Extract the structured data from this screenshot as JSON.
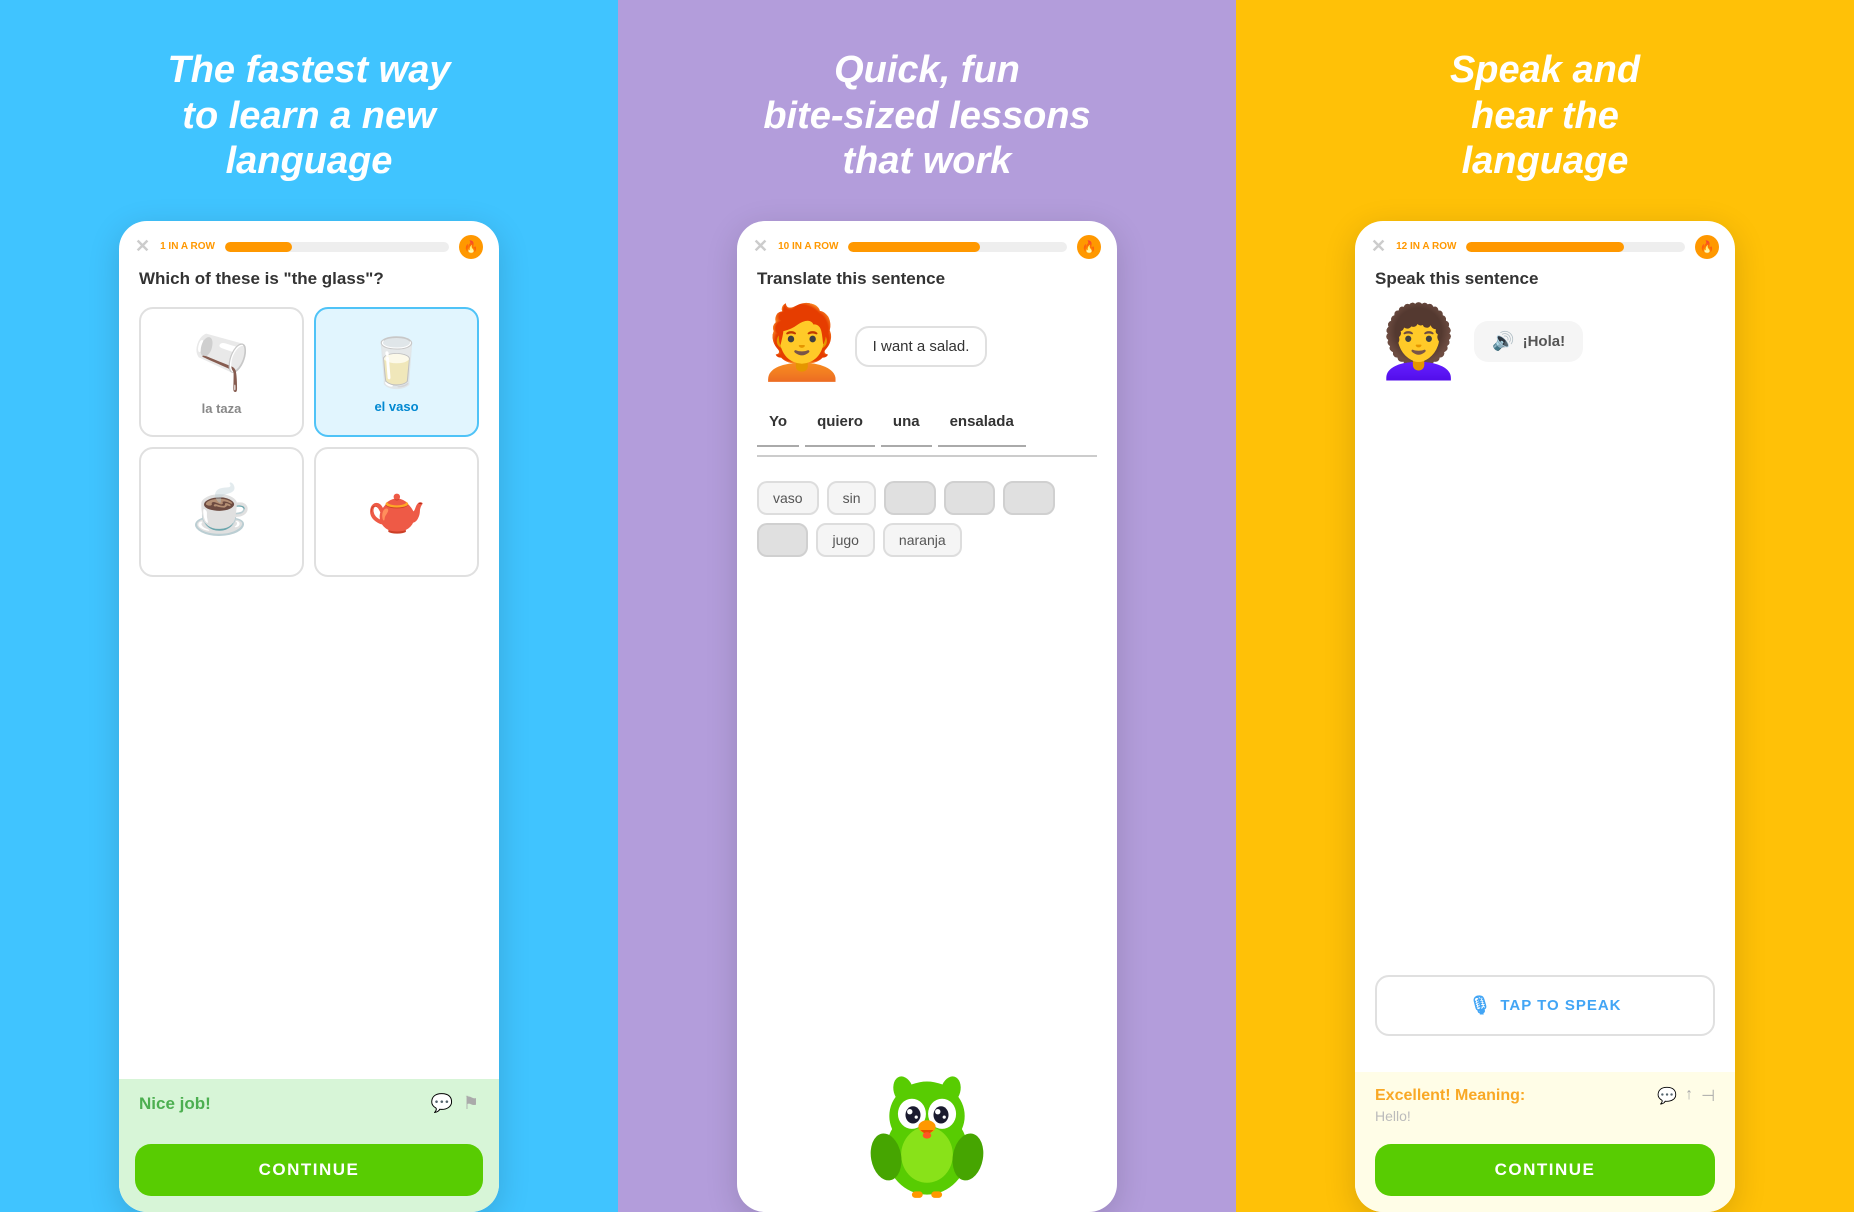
{
  "panel1": {
    "bg": "#40c4ff",
    "title": "The fastest way\nto learn a new\nlanguage",
    "progress": {
      "label": "1 IN A ROW",
      "fill_pct": 30
    },
    "question": "Which of these is \"the glass\"?",
    "cells": [
      {
        "id": "la-taza",
        "label": "la taza",
        "icon": "🫖",
        "selected": false
      },
      {
        "id": "el-vaso",
        "label": "el vaso",
        "icon": "🥛",
        "selected": true
      },
      {
        "id": "coffee-bag",
        "label": "",
        "icon": "☕",
        "selected": false
      },
      {
        "id": "coffee-pot",
        "label": "",
        "icon": "🫖",
        "selected": false
      }
    ],
    "feedback": "Nice job!",
    "continue_label": "CONTINUE"
  },
  "panel2": {
    "bg": "#b39ddb",
    "title": "Quick, fun\nbite-sized lessons\nthat work",
    "progress": {
      "label": "10 IN A ROW",
      "fill_pct": 60
    },
    "question": "Translate this sentence",
    "speech_text": "I want a salad.",
    "answer_words": [
      "Yo",
      "quiero",
      "una",
      "ensalada"
    ],
    "word_bank": [
      {
        "text": "vaso",
        "grey": false
      },
      {
        "text": "sin",
        "grey": false
      },
      {
        "text": "",
        "grey": true
      },
      {
        "text": "",
        "grey": true
      },
      {
        "text": "",
        "grey": true
      },
      {
        "text": "",
        "grey": true
      },
      {
        "text": "jugo",
        "grey": false
      },
      {
        "text": "naranja",
        "grey": false
      }
    ]
  },
  "panel3": {
    "bg": "#ffc107",
    "title": "Speak and\nhear the\nlanguage",
    "progress": {
      "label": "12 IN A ROW",
      "fill_pct": 72
    },
    "question": "Speak this sentence",
    "hola_text": "¡Hola!",
    "tap_label": "TAP TO SPEAK",
    "excellent_title": "Excellent! Meaning:",
    "excellent_meaning": "Hello!",
    "continue_label": "CONTINUE"
  },
  "icons": {
    "close": "✕",
    "flame": "🔥",
    "chat": "💬",
    "flag": "⚑",
    "like": "👍",
    "share": "↑",
    "bookmark": "⊣",
    "mic": "🎙",
    "speaker": "🔊"
  }
}
